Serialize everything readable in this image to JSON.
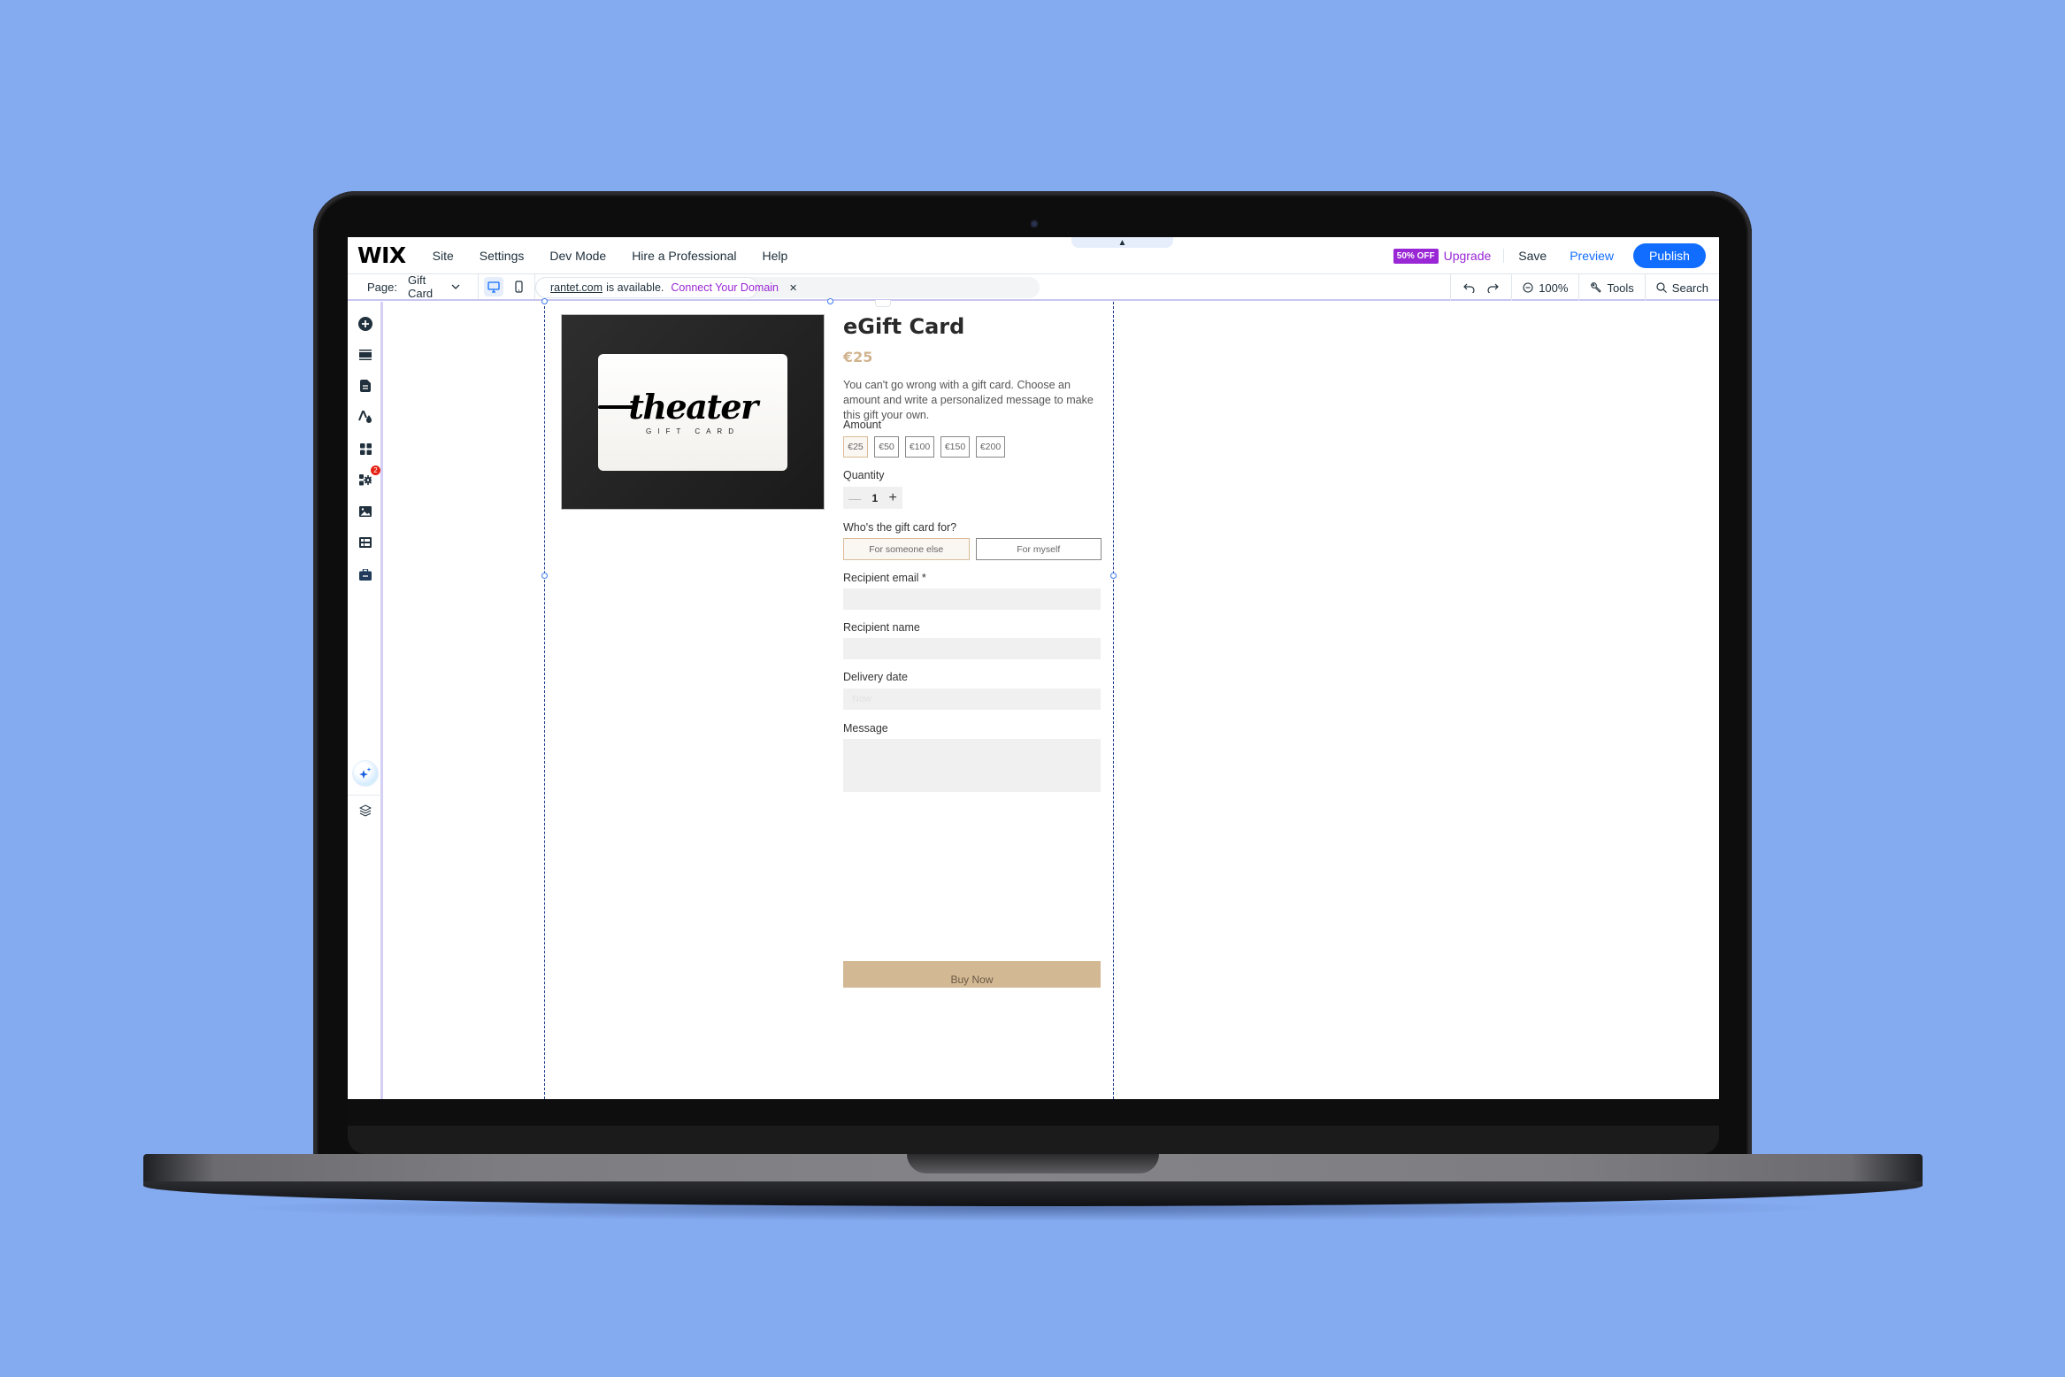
{
  "editor": {
    "logo": "WIX",
    "menu": [
      "Site",
      "Settings",
      "Dev Mode",
      "Hire a Professional",
      "Help"
    ],
    "collapse_icon": "chevron-up-icon",
    "sale_badge": "50% OFF",
    "upgrade_label": "Upgrade",
    "save_label": "Save",
    "preview_label": "Preview",
    "publish_label": "Publish",
    "colors": {
      "accent": "#116dff",
      "upgrade": "#9a27d5",
      "badge": "#e62214"
    }
  },
  "toolbar": {
    "page_label": "Page:",
    "page_value": "Gift Card",
    "devices": [
      {
        "icon": "desktop-icon",
        "active": true
      },
      {
        "icon": "mobile-icon",
        "active": false
      }
    ],
    "domain": {
      "name": "rantet.com",
      "status": "is available.",
      "connect_label": "Connect Your Domain",
      "close_icon": "close-icon"
    },
    "zoom_label": "100%",
    "tools_label": "Tools",
    "search_label": "Search"
  },
  "rail": {
    "items": [
      {
        "icon": "add-elements-icon"
      },
      {
        "icon": "sections-icon"
      },
      {
        "icon": "pages-icon"
      },
      {
        "icon": "site-design-icon"
      },
      {
        "icon": "apps-icon"
      },
      {
        "icon": "business-apps-icon",
        "badge": "2"
      },
      {
        "icon": "media-icon"
      },
      {
        "icon": "cms-icon"
      },
      {
        "icon": "portfolio-icon"
      }
    ],
    "ai_icon": "ai-assistant-icon",
    "layers_icon": "layers-icon"
  },
  "product": {
    "image": {
      "brand": "theater",
      "subtitle": "GIFT CARD"
    },
    "title": "eGift Card",
    "price": "€25",
    "description": "You can't go wrong with a gift card. Choose an amount and write a personalized message to make this gift your own.",
    "amount_label": "Amount",
    "amounts": [
      "€25",
      "€50",
      "€100",
      "€150",
      "€200"
    ],
    "selected_amount": "€25",
    "quantity_label": "Quantity",
    "quantity": "1",
    "recipient_question": "Who's the gift card for?",
    "recipient_options": [
      "For someone else",
      "For myself"
    ],
    "selected_recipient": "For someone else",
    "recipient_email_label": "Recipient email *",
    "recipient_email_value": "",
    "recipient_name_label": "Recipient name",
    "recipient_name_value": "",
    "delivery_date_label": "Delivery date",
    "delivery_date_placeholder": "Now",
    "message_label": "Message",
    "message_value": "",
    "buy_label": "Buy Now",
    "colors": {
      "price": "#d1b38f",
      "button": "#d3b894"
    }
  }
}
